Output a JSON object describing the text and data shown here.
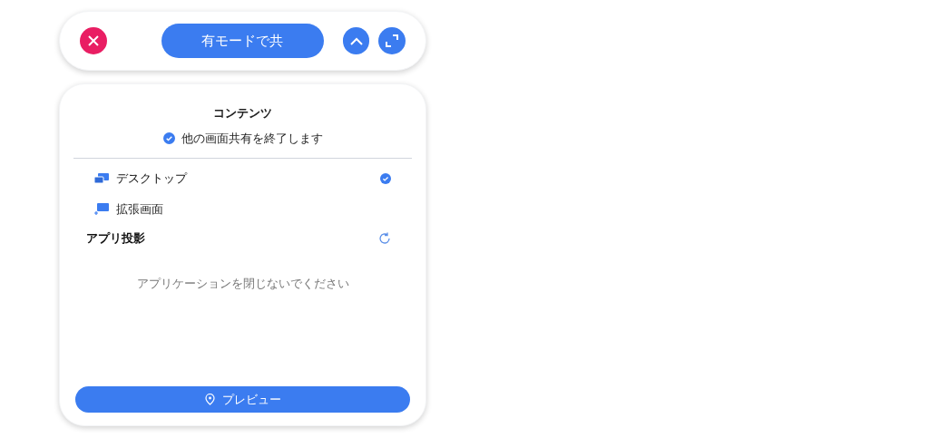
{
  "toolbar": {
    "share_button": "有モードで共"
  },
  "panel": {
    "title": "コンテンツ",
    "end_other_sharing": {
      "label": "他の画面共有を終了します",
      "checked": true
    },
    "sources": [
      {
        "kind": "desktop",
        "label": "デスクトップ",
        "selected": true
      },
      {
        "kind": "extended",
        "label": "拡張画面",
        "selected": false
      }
    ],
    "app_projection": {
      "title": "アプリ投影",
      "message": "アプリケーションを閉じないでください"
    },
    "preview_button": "プレビュー"
  }
}
